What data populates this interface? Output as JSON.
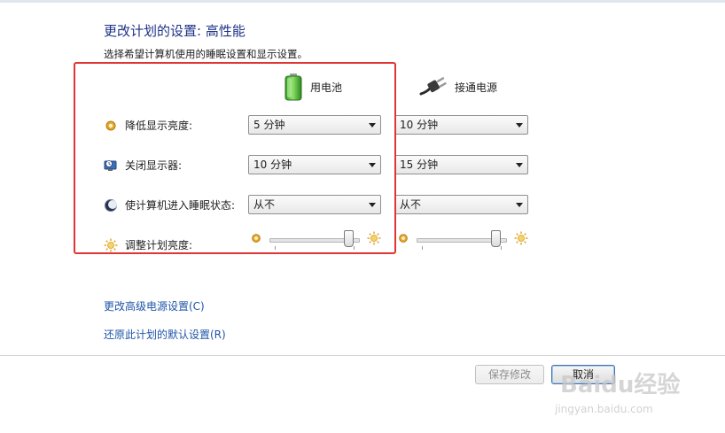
{
  "page": {
    "title": "更改计划的设置: 高性能",
    "subtitle": "选择希望计算机使用的睡眠设置和显示设置。"
  },
  "columns": {
    "battery": {
      "label": "用电池",
      "icon": "battery-icon"
    },
    "plugged": {
      "label": "接通电源",
      "icon": "power-plug-icon"
    }
  },
  "settings": [
    {
      "label": "降低显示亮度:",
      "icon": "dim-brightness-icon",
      "battery_value": "5 分钟",
      "plugged_value": "10 分钟"
    },
    {
      "label": "关闭显示器:",
      "icon": "monitor-clock-icon",
      "battery_value": "10 分钟",
      "plugged_value": "15 分钟"
    },
    {
      "label": "使计算机进入睡眠状态:",
      "icon": "sleep-moon-icon",
      "battery_value": "从不",
      "plugged_value": "从不"
    }
  ],
  "brightness": {
    "label": "调整计划亮度:",
    "icon": "sun-icon",
    "battery_level": 0.92,
    "plugged_level": 0.92
  },
  "links": {
    "advanced": "更改高级电源设置(C)",
    "restore": "还原此计划的默认设置(R)"
  },
  "buttons": {
    "save": "保存修改",
    "cancel": "取消"
  },
  "watermark": {
    "brand": "Baidu经验",
    "url": "jingyan.baidu.com"
  },
  "colors": {
    "title": "#1e3287",
    "link": "#1f55a8",
    "highlight": "#e03535"
  }
}
